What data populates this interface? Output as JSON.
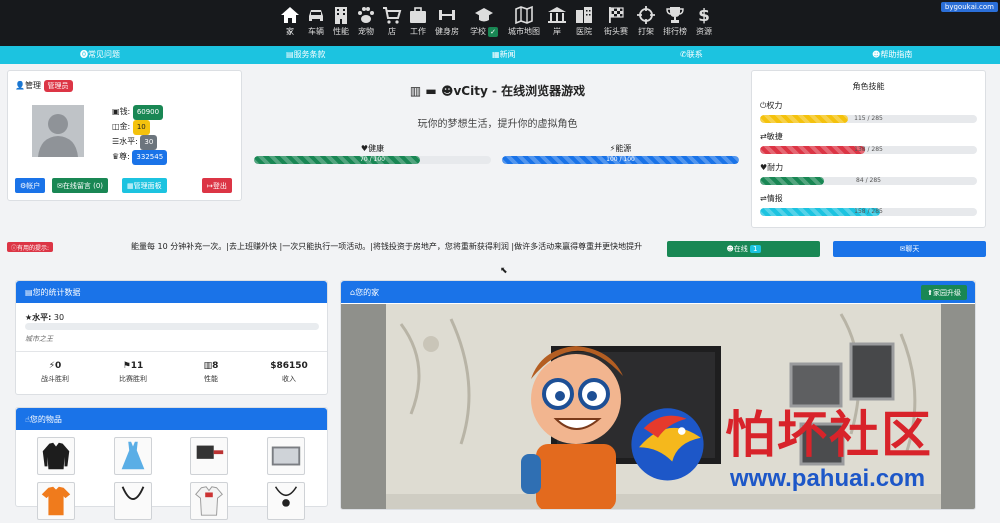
{
  "topnav": {
    "user_tag": "bygoukai.com",
    "items": [
      {
        "label": "家",
        "icon": "home-icon"
      },
      {
        "label": "车辆",
        "icon": "car-icon"
      },
      {
        "label": "性能",
        "icon": "building-icon"
      },
      {
        "label": "宠物",
        "icon": "paw-icon"
      },
      {
        "label": "店",
        "icon": "cart-icon"
      },
      {
        "label": "工作",
        "icon": "briefcase-icon"
      },
      {
        "label": "健身房",
        "icon": "dumbbell-icon"
      },
      {
        "label": "学校",
        "icon": "graduation-cap-icon"
      },
      {
        "label": "城市地图",
        "icon": "map-icon"
      },
      {
        "label": "岸",
        "icon": "bank-icon"
      },
      {
        "label": "医院",
        "icon": "hospital-icon"
      },
      {
        "label": "街头赛",
        "icon": "flag-checkered-icon"
      },
      {
        "label": "打架",
        "icon": "crosshairs-icon"
      },
      {
        "label": "排行榜",
        "icon": "trophy-icon"
      },
      {
        "label": "资源",
        "icon": "dollar-icon"
      }
    ]
  },
  "subnav": {
    "faq": "常见问题",
    "terms": "服务条款",
    "news": "新闻",
    "contact": "联系",
    "help": "帮助指南"
  },
  "profile": {
    "title": "管理",
    "role_badge": "管理员",
    "money_label": "钱:",
    "money": "60900",
    "gold_label": "金:",
    "gold": "10",
    "level_label": "水平:",
    "level": "30",
    "respect_label": "尊:",
    "respect": "332545",
    "btn_account": "帐户",
    "btn_messages": "在线留言",
    "btn_messages_count": "(0)",
    "btn_admin": "管理面板",
    "btn_logout": "登出"
  },
  "hero": {
    "title": "vCity - 在线浏览器游戏",
    "subtitle": "玩你的梦想生活，提升你的虚拟角色",
    "health_label": "健康",
    "health_text": "70 / 100",
    "health_fraction": 0.7,
    "energy_label": "能源",
    "energy_text": "100 / 100",
    "energy_fraction": 1.0
  },
  "skills": {
    "title": "角色技能",
    "items": [
      {
        "label": "权力",
        "text": "115 / 285",
        "fraction": 0.4035,
        "color": "#f4c20d",
        "icon": "power-icon"
      },
      {
        "label": "敏捷",
        "text": "138 / 285",
        "fraction": 0.4842,
        "color": "#dc3545",
        "icon": "retweet-icon"
      },
      {
        "label": "耐力",
        "text": "84 / 285",
        "fraction": 0.2947,
        "color": "#198754",
        "icon": "heart-pulse-icon"
      },
      {
        "label": "情报",
        "text": "158 / 285",
        "fraction": 0.5544,
        "color": "#1cc3e0",
        "icon": "usb-icon"
      }
    ]
  },
  "ticker": {
    "badge": "有用的提示:",
    "text": "能量每 10 分钟补充一次。|去上班赚外快 |一次只能执行一项活动。|将钱投资于房地产，您将重新获得利润 |做许多活动来赢得尊重并更快地提升",
    "online_label": "在线",
    "online_count": "1",
    "chat_label": "聊天"
  },
  "stats": {
    "header": "您的统计数据",
    "level_label": "水平:",
    "level": "30",
    "rank": "城市之王",
    "cells": [
      {
        "value": "0",
        "label": "战斗胜利",
        "icon": "bolt-icon"
      },
      {
        "value": "11",
        "label": "比赛胜利",
        "icon": "flag-icon"
      },
      {
        "value": "8",
        "label": "性能",
        "icon": "building-icon"
      },
      {
        "value": "$86150",
        "label": "收入",
        "icon": ""
      }
    ]
  },
  "items_card": {
    "header": "您的物品",
    "items": [
      "jacket-icon",
      "dress-icon",
      "cleaver-icon",
      "tv-icon",
      "tshirt-icon",
      "necklace-icon",
      "shirt-icon",
      "pendant-icon"
    ]
  },
  "home_card": {
    "header": "您的家",
    "upgrade_label": "家园升级"
  },
  "watermark": {
    "cn": "怕坏社区",
    "url": "www.pahuai.com"
  }
}
